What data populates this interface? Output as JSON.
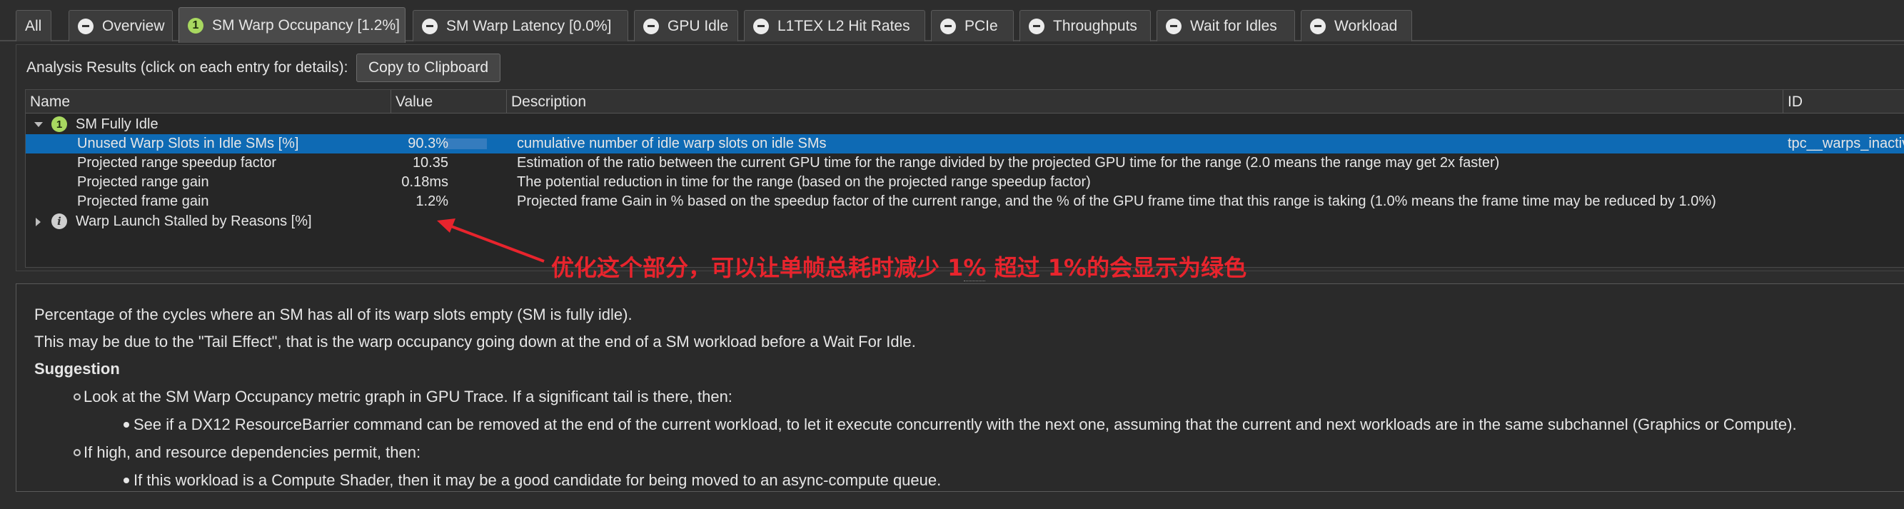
{
  "tabs": [
    {
      "label": "All",
      "icon": "none"
    },
    {
      "label": "Overview",
      "icon": "minus-circle-icon"
    },
    {
      "label": "SM Warp Occupancy [1.2%]",
      "icon": "number-one-badge",
      "badge": "1",
      "active": true
    },
    {
      "label": "SM Warp Latency [0.0%]",
      "icon": "minus-circle-icon"
    },
    {
      "label": "GPU Idle",
      "icon": "minus-circle-icon"
    },
    {
      "label": "L1TEX L2 Hit Rates",
      "icon": "minus-circle-icon"
    },
    {
      "label": "PCIe",
      "icon": "minus-circle-icon"
    },
    {
      "label": "Throughputs",
      "icon": "minus-circle-icon"
    },
    {
      "label": "Wait for Idles",
      "icon": "minus-circle-icon"
    },
    {
      "label": "Workload",
      "icon": "minus-circle-icon"
    }
  ],
  "results": {
    "label": "Analysis Results (click on each entry for details):",
    "copy_button": "Copy to Clipboard",
    "columns": [
      "Name",
      "Value",
      "Description",
      "ID"
    ],
    "groups": [
      {
        "name": "SM Fully Idle",
        "badge": "1",
        "expanded": true
      },
      {
        "name": "Warp Launch Stalled by Reasons [%]",
        "badge": "i",
        "expanded": false
      }
    ],
    "rows": [
      {
        "name": "Unused Warp Slots in Idle SMs [%]",
        "value": "90.3%",
        "bar_fraction": 0.903,
        "description": "cumulative number of idle warp slots on idle SMs",
        "id": "tpc__warps_inactive_",
        "selected": true
      },
      {
        "name": "Projected range speedup factor",
        "value": "10.35",
        "description": "Estimation of the ratio between the current GPU time for the range divided by the projected GPU time for the range (2.0 means the range may get 2x faster)",
        "id": ""
      },
      {
        "name": "Projected range gain",
        "value": "0.18ms",
        "description": "The potential reduction in time for the range (based on the projected range speedup factor)",
        "id": ""
      },
      {
        "name": "Projected frame gain",
        "value": "1.2%",
        "description": "Projected frame Gain in % based on the speedup factor of the current range, and the % of the GPU frame time that this range is taking (1.0% means the frame time may be reduced by 1.0%)",
        "id": ""
      }
    ]
  },
  "annotation": {
    "text": "优化这个部分，可以让单帧总耗时减少 1% 超过 1%的会显示为绿色",
    "color": "#e8242d"
  },
  "details": {
    "line1": "Percentage of the cycles where an SM has all of its warp slots empty (SM is fully idle).",
    "line2": "This may be due to the \"Tail Effect\", that is the warp occupancy going down at the end of a SM workload before a Wait For Idle.",
    "suggestion_heading": "Suggestion",
    "item1": "Look at the SM Warp Occupancy metric graph in GPU Trace. If a significant tail is there, then:",
    "item1_sub": "See if a DX12 ResourceBarrier command can be removed at the end of the current workload, to let it execute concurrently with the next one, assuming that the current and next workloads are in the same subchannel (Graphics or Compute).",
    "item2": "If high, and resource dependencies permit, then:",
    "item2_sub": "If this workload is a Compute Shader, then it may be a good candidate for being moved to an async-compute queue."
  },
  "colors": {
    "selection": "#0e6ab4",
    "badge_green": "#a8d860",
    "annotation_red": "#e8242d"
  }
}
